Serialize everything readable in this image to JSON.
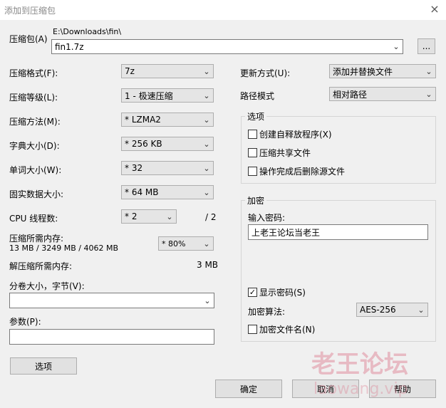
{
  "window": {
    "title": "添加到压缩包",
    "close_icon": "×"
  },
  "archive": {
    "label": "压缩包(A)",
    "path": "E:\\Downloads\\fin\\",
    "filename": "fin1.7z",
    "browse_label": "..."
  },
  "left": {
    "format": {
      "label": "压缩格式(F):",
      "value": "7z"
    },
    "level": {
      "label": "压缩等级(L):",
      "value": "1 - 极速压缩"
    },
    "method": {
      "label": "压缩方法(M):",
      "value": "*  LZMA2"
    },
    "dict": {
      "label": "字典大小(D):",
      "value": "*  256 KB"
    },
    "word": {
      "label": "单词大小(W):",
      "value": "*  32"
    },
    "solid": {
      "label": "固实数据大小:",
      "value": "*  64 MB"
    },
    "cpu": {
      "label": "CPU 线程数:",
      "value": "*  2",
      "max": "/ 2"
    },
    "mem": {
      "label": "压缩所需内存:",
      "detail": "13 MB / 3249 MB / 4062 MB",
      "value": "* 80%"
    },
    "decomp": {
      "label": "解压缩所需内存:",
      "value": "3 MB"
    },
    "split": {
      "label": "分卷大小，字节(V):",
      "value": ""
    },
    "params": {
      "label": "参数(P):",
      "value": ""
    },
    "options_button": "选项"
  },
  "right": {
    "update": {
      "label": "更新方式(U):",
      "value": "添加并替换文件"
    },
    "pathmode": {
      "label": "路径模式",
      "value": "相对路径"
    },
    "options_group": {
      "title": "选项",
      "items": [
        {
          "label": "创建自释放程序(X)",
          "checked": false
        },
        {
          "label": "压缩共享文件",
          "checked": false
        },
        {
          "label": "操作完成后删除源文件",
          "checked": false
        }
      ]
    },
    "encryption": {
      "title": "加密",
      "password_label": "输入密码:",
      "password_value": "上老王论坛当老王",
      "show_password": {
        "label": "显示密码(S)",
        "checked": true
      },
      "method_label": "加密算法:",
      "method_value": "AES-256",
      "encrypt_names": {
        "label": "加密文件名(N)",
        "checked": false
      }
    }
  },
  "buttons": {
    "ok": "确定",
    "cancel": "取消",
    "help": "帮助"
  },
  "watermark": {
    "line1": "老王论坛",
    "line2": "laowang.vip"
  },
  "icons": {
    "dropdown": "chevron-down-icon",
    "check": "check-icon"
  }
}
